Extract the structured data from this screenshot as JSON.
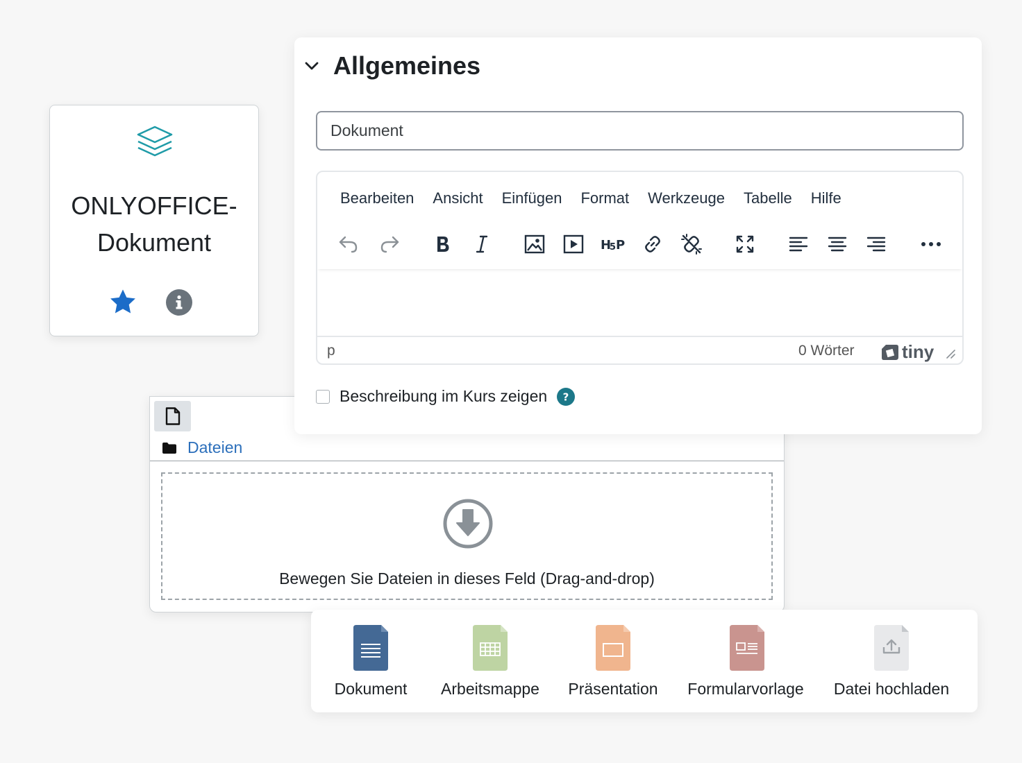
{
  "activity": {
    "title_line1": "ONLYOFFICE-",
    "title_line2": "Dokument",
    "icon": "layers-icon",
    "accent": "#1f9ba8"
  },
  "files": {
    "path_label": "Dateien",
    "drop_text": "Bewegen Sie Dateien in dieses Feld (Drag-and-drop)"
  },
  "general": {
    "section_title": "Allgemeines",
    "name_value": "Dokument",
    "editor": {
      "menu": [
        "Bearbeiten",
        "Ansicht",
        "Einfügen",
        "Format",
        "Werkzeuge",
        "Tabelle",
        "Hilfe"
      ],
      "status_path": "p",
      "word_count": "0 Wörter",
      "brand": "tiny"
    },
    "show_description_label": "Beschreibung im Kurs zeigen"
  },
  "create": {
    "items": [
      {
        "label": "Dokument",
        "color": "#446995"
      },
      {
        "label": "Arbeitsmappe",
        "color": "#bed4a3"
      },
      {
        "label": "Präsentation",
        "color": "#f0b58e"
      },
      {
        "label": "Formularvorlage",
        "color": "#c9948f"
      },
      {
        "label": "Datei hochladen",
        "color": "#e8e9eb"
      }
    ]
  }
}
